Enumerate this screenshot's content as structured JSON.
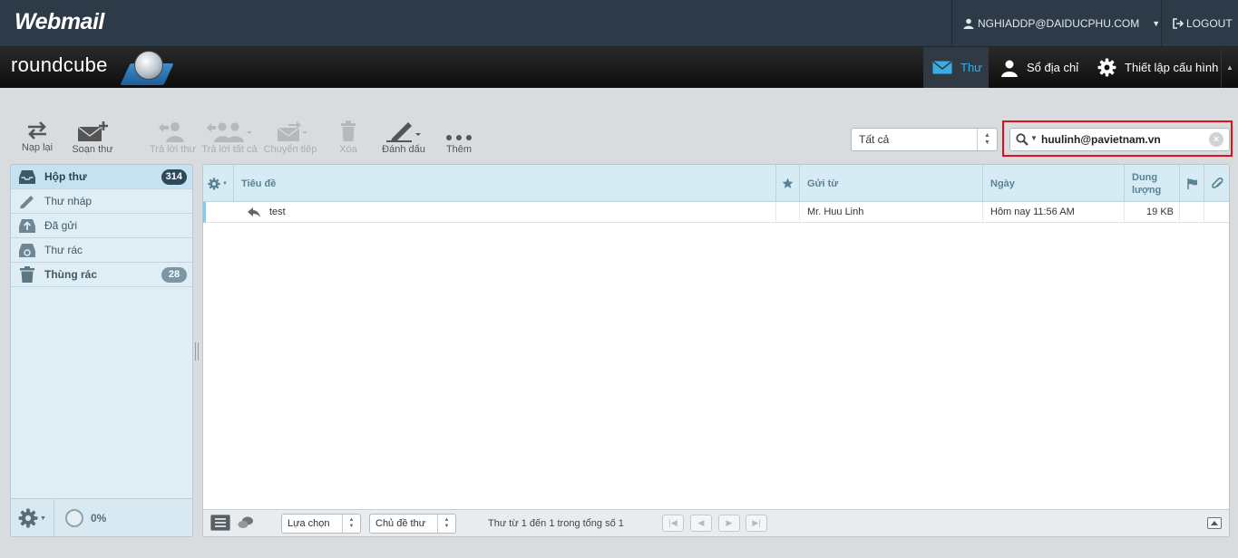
{
  "header": {
    "app_logo": "Webmail",
    "user": "NGHIADDP@DAIDUCPHU.COM",
    "logout": "LOGOUT",
    "brand": "roundcube"
  },
  "nav": {
    "mail": "Thư",
    "contacts": "Sổ địa chỉ",
    "settings": "Thiết lập cấu hình"
  },
  "toolbar": {
    "refresh": "Nạp lại",
    "compose": "Soạn thư",
    "reply": "Trả lời thư",
    "reply_all": "Trả lời tất cả",
    "forward": "Chuyển tiếp",
    "delete": "Xóa",
    "mark": "Đánh dấu",
    "more": "Thêm"
  },
  "filter": {
    "selected": "Tất cả"
  },
  "search": {
    "value": "huulinh@pavietnam.vn"
  },
  "folders": [
    {
      "name": "Hộp thư",
      "count": "314"
    },
    {
      "name": "Thư nháp"
    },
    {
      "name": "Đã gửi"
    },
    {
      "name": "Thư rác"
    },
    {
      "name": "Thùng rác",
      "count": "28"
    }
  ],
  "quota": "0%",
  "list": {
    "columns": {
      "subject": "Tiêu đề",
      "from": "Gửi từ",
      "date": "Ngày",
      "size_line1": "Dung",
      "size_line2": "lượng"
    },
    "rows": [
      {
        "subject": "test",
        "from": "Mr. Huu Linh",
        "date": "Hôm nay 11:56 AM",
        "size": "19 KB"
      }
    ]
  },
  "footer": {
    "select": "Lựa chọn",
    "threads": "Chủ đề thư",
    "count": "Thư từ 1 đến 1 trong tổng số 1"
  },
  "colors": {
    "accent": "#39aee6",
    "highlight_border": "#e0101b"
  }
}
